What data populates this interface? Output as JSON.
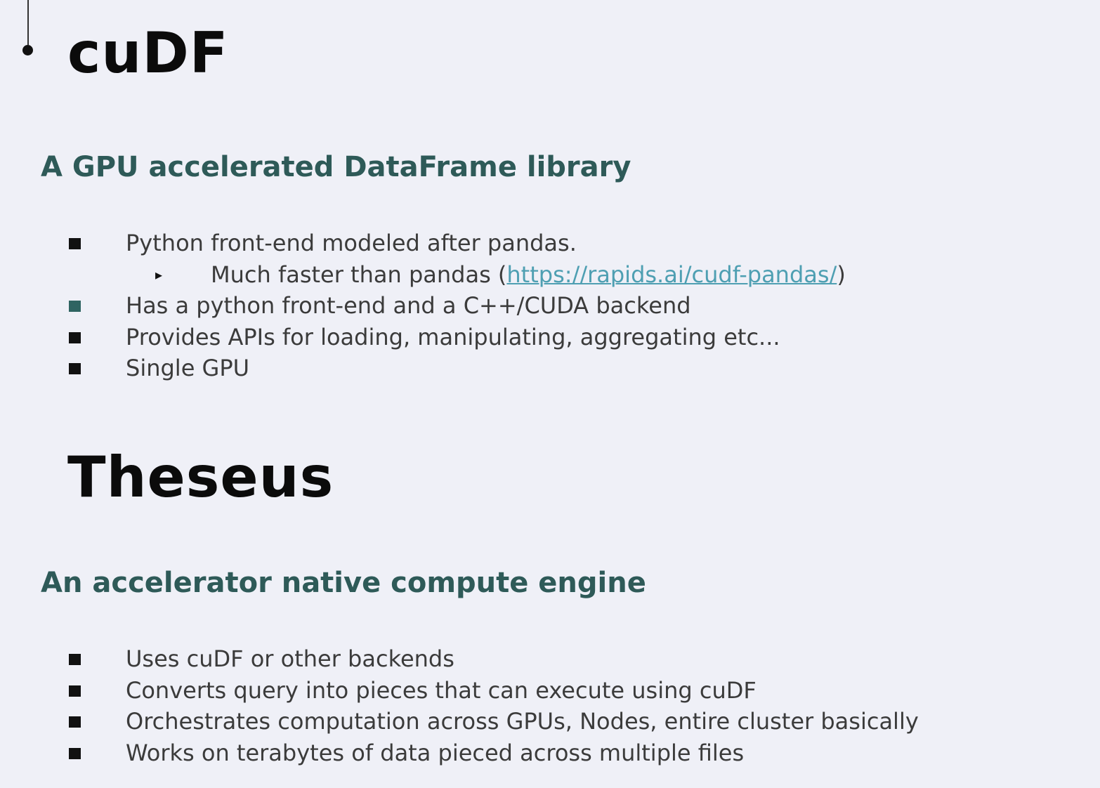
{
  "sections": {
    "cudf": {
      "title": "cuDF",
      "subtitle": "A GPU accelerated DataFrame library",
      "bullets": [
        "Python front-end modeled after pandas.",
        "Has a python front-end and a C++/CUDA backend",
        "Provides APIs for loading, manipulating, aggregating etc...",
        "Single GPU"
      ],
      "sub_bullet": {
        "prefix": "Much faster than pandas (",
        "link_text": "https://rapids.ai/cudf-pandas/",
        "suffix": ")",
        "arrow_glyph": "▸"
      }
    },
    "theseus": {
      "title": "Theseus",
      "subtitle": "An accelerator native compute engine",
      "bullets": [
        "Uses cuDF or other backends",
        "Converts query into pieces that can execute using cuDF",
        "Orchestrates computation across GPUs, Nodes, entire cluster basically",
        "Works on terabytes of data pieced across multiple files"
      ]
    }
  },
  "colors": {
    "background": "#eff0f7",
    "title": "#0b0b0b",
    "subtitle": "#2e5a58",
    "body_text": "#3b3b3b",
    "link": "#4e9fb2",
    "highlight_bullet": "#2f6462"
  }
}
